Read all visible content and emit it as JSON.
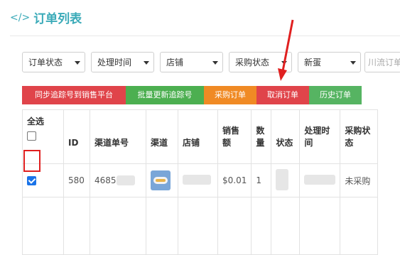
{
  "header": {
    "icon": "code-icon",
    "title": "订单列表"
  },
  "filters": {
    "order_status": "订单状态",
    "process_time": "处理时间",
    "store": "店铺",
    "purchase_status": "采购状态",
    "supplier": "新蛋",
    "search_placeholder": "川流订单"
  },
  "actions": {
    "sync_tracking": "同步追踪号到销售平台",
    "batch_update": "批量更新追踪号",
    "purchase_order": "采购订单",
    "cancel_order": "取消订单",
    "history_order": "历史订单"
  },
  "table": {
    "select_all": "全选",
    "columns": [
      "ID",
      "渠道单号",
      "渠道",
      "店铺",
      "销售额",
      "数量",
      "状态",
      "处理时间",
      "采购状态"
    ],
    "rows": [
      {
        "id": "580",
        "channel_no": "4685",
        "amount": "$0.01",
        "qty": "1",
        "purchase_status": "未采购"
      }
    ]
  },
  "colors": {
    "title": "#3aaab8",
    "sync": "#e0444a",
    "batch": "#4caf50",
    "purchase": "#f08a24",
    "cancel": "#e0444a",
    "history": "#56b462"
  }
}
